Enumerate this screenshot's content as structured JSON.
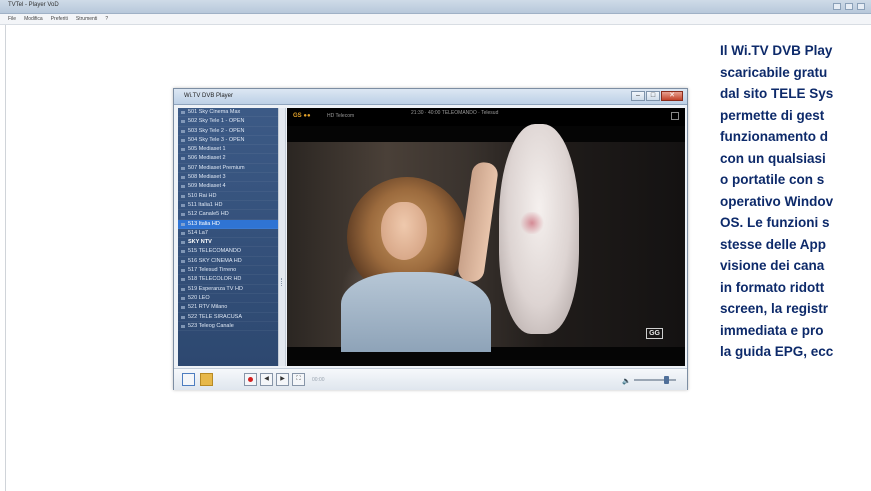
{
  "outer_window": {
    "title": "TVTel - Player VoD",
    "menu": [
      "File",
      "Modifica",
      "Preferiti",
      "Strumenti",
      "?"
    ]
  },
  "player": {
    "title": "Wi.TV DVB Player",
    "min_label": "–",
    "max_label": "□",
    "close_label": "✕",
    "channels": [
      {
        "label": "501 Sky Cinema Max"
      },
      {
        "label": "502 Sky Tele 1 - OPEN"
      },
      {
        "label": "503 Sky Tele 2 - OPEN"
      },
      {
        "label": "504 Sky Tele 3 - OPEN"
      },
      {
        "label": "505 Mediaset 1"
      },
      {
        "label": "506 Mediaset 2"
      },
      {
        "label": "507 Mediaset Premium"
      },
      {
        "label": "508 Mediaset 3"
      },
      {
        "label": "509 Mediaset 4"
      },
      {
        "label": "510 Rai HD"
      },
      {
        "label": "511 Italia1 HD"
      },
      {
        "label": "512 Canale5 HD"
      },
      {
        "label": "513 Italia HD",
        "selected": true
      },
      {
        "label": "514 La7"
      },
      {
        "label": "SKY NTV",
        "group": true
      },
      {
        "label": "515 TELECOMANDO"
      },
      {
        "label": "516 SKY CINEMA HD"
      },
      {
        "label": "517 Telesud Tirreno"
      },
      {
        "label": "518 TELECOLOR HD"
      },
      {
        "label": "519 Esperanza TV HD"
      },
      {
        "label": "520 LEO"
      },
      {
        "label": "521 RTV Milano"
      },
      {
        "label": "522 TELE SIRACUSA"
      },
      {
        "label": "523 Teleog Canale"
      }
    ],
    "osd": {
      "logo": "GS ●●",
      "info": "HD  Telecom",
      "program": "21:30 · 40:00  TELEOMANDO · Telesud"
    },
    "channel_logo": "GG",
    "toolbar": {
      "prev_label": "◀",
      "next_label": "▶",
      "full_label": "⛶",
      "status": "00:00",
      "volume_icon": "🔈",
      "volume_level": 0.75
    }
  },
  "caption": {
    "lines": [
      "Il Wi.TV DVB Play",
      "scaricabile gratu",
      "dal sito TELE Sys",
      "permette di gest",
      "funzionamento d",
      "con un qualsiasi",
      "o portatile con s",
      "operativo Windov",
      "OS. Le funzioni s",
      "stesse delle App",
      "visione dei cana",
      "in formato ridott",
      "screen, la registr",
      "immediata e pro",
      "la guida EPG, ecc"
    ]
  },
  "colors": {
    "caption_text": "#0d2a6a",
    "channel_list_bg": "#2d4870",
    "selected_row": "#2f74d4",
    "record_red": "#d42020"
  }
}
